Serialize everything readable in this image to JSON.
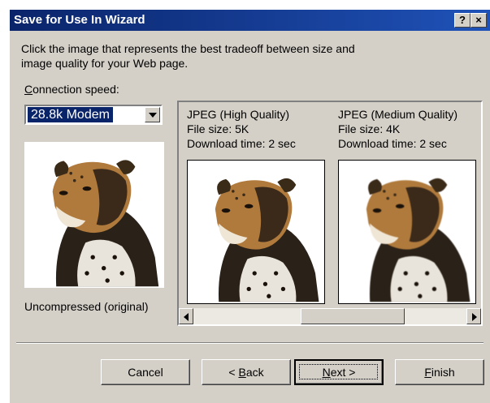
{
  "dialog": {
    "title": "Save for Use In Wizard",
    "help_label": "?",
    "close_label": "×",
    "instruction_line1": "Click the image that represents the best tradeoff between size and",
    "instruction_line2": "image quality for your Web page."
  },
  "connection": {
    "label_prefix": "C",
    "label_rest": "onnection speed:",
    "selected": "28.8k Modem"
  },
  "original": {
    "caption": "Uncompressed (original)"
  },
  "previews": [
    {
      "format": "JPEG (High Quality)",
      "file_size": "File size: 5K",
      "download_time": "Download time: 2 sec"
    },
    {
      "format": "JPEG (Medium Quality)",
      "file_size": "File size: 4K",
      "download_time": "Download time: 2 sec"
    }
  ],
  "buttons": {
    "cancel": "Cancel",
    "back_prefix": "< ",
    "back_mnemonic": "B",
    "back_rest": "ack",
    "next_mnemonic": "N",
    "next_rest": "ext >",
    "finish_mnemonic": "F",
    "finish_rest": "inish"
  },
  "colors": {
    "title_bar": "#0a246a",
    "dialog_face": "#d4d0c8",
    "selection": "#0a246a"
  },
  "icons": [
    "help-icon",
    "close-icon",
    "dropdown-arrow-icon",
    "scroll-left-icon",
    "scroll-right-icon"
  ]
}
